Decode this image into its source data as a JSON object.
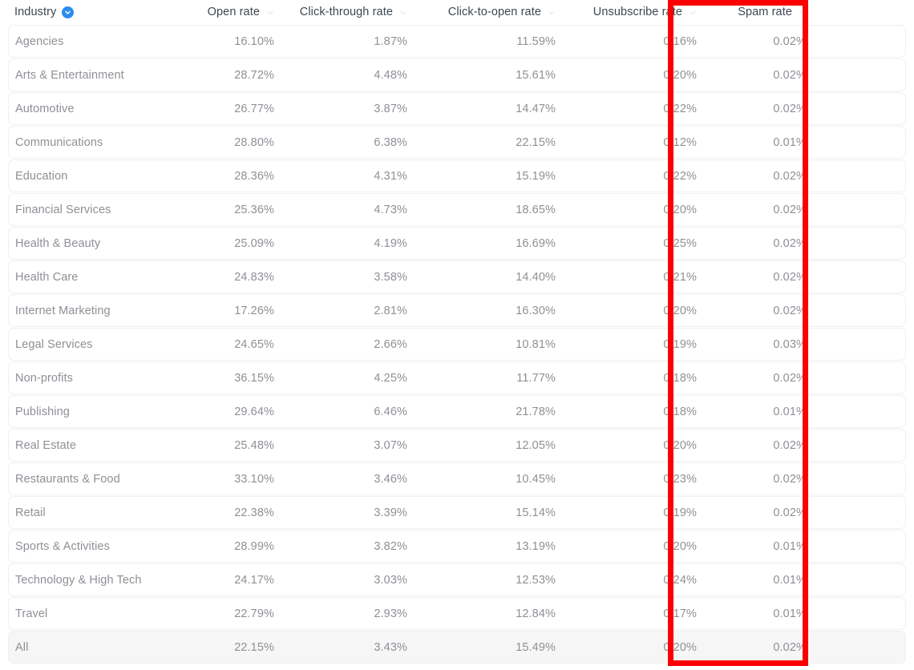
{
  "table": {
    "columns": [
      {
        "key": "industry",
        "label": "Industry",
        "sort_badge_icon": "chevron-down-icon",
        "sort_active": true
      },
      {
        "key": "open_rate",
        "label": "Open rate",
        "sort_icon": "chevron-down-icon",
        "sort_active": false
      },
      {
        "key": "click_through_rate",
        "label": "Click-through rate",
        "sort_icon": "chevron-down-icon",
        "sort_active": false
      },
      {
        "key": "click_to_open_rate",
        "label": "Click-to-open rate",
        "sort_icon": "chevron-down-icon",
        "sort_active": false
      },
      {
        "key": "unsubscribe_rate",
        "label": "Unsubscribe rate",
        "sort_icon": "chevron-down-icon",
        "sort_active": false
      },
      {
        "key": "spam_rate",
        "label": "Spam rate",
        "sort_icon": "chevron-down-icon",
        "sort_active": false
      }
    ],
    "rows": [
      {
        "industry": "Agencies",
        "open_rate": "16.10%",
        "click_through_rate": "1.87%",
        "click_to_open_rate": "11.59%",
        "unsubscribe_rate": "0.16%",
        "spam_rate": "0.02%",
        "is_total": false
      },
      {
        "industry": "Arts & Entertainment",
        "open_rate": "28.72%",
        "click_through_rate": "4.48%",
        "click_to_open_rate": "15.61%",
        "unsubscribe_rate": "0.20%",
        "spam_rate": "0.02%",
        "is_total": false
      },
      {
        "industry": "Automotive",
        "open_rate": "26.77%",
        "click_through_rate": "3.87%",
        "click_to_open_rate": "14.47%",
        "unsubscribe_rate": "0.22%",
        "spam_rate": "0.02%",
        "is_total": false
      },
      {
        "industry": "Communications",
        "open_rate": "28.80%",
        "click_through_rate": "6.38%",
        "click_to_open_rate": "22.15%",
        "unsubscribe_rate": "0.12%",
        "spam_rate": "0.01%",
        "is_total": false
      },
      {
        "industry": "Education",
        "open_rate": "28.36%",
        "click_through_rate": "4.31%",
        "click_to_open_rate": "15.19%",
        "unsubscribe_rate": "0.22%",
        "spam_rate": "0.02%",
        "is_total": false
      },
      {
        "industry": "Financial Services",
        "open_rate": "25.36%",
        "click_through_rate": "4.73%",
        "click_to_open_rate": "18.65%",
        "unsubscribe_rate": "0.20%",
        "spam_rate": "0.02%",
        "is_total": false
      },
      {
        "industry": "Health & Beauty",
        "open_rate": "25.09%",
        "click_through_rate": "4.19%",
        "click_to_open_rate": "16.69%",
        "unsubscribe_rate": "0.25%",
        "spam_rate": "0.02%",
        "is_total": false
      },
      {
        "industry": "Health Care",
        "open_rate": "24.83%",
        "click_through_rate": "3.58%",
        "click_to_open_rate": "14.40%",
        "unsubscribe_rate": "0.21%",
        "spam_rate": "0.02%",
        "is_total": false
      },
      {
        "industry": "Internet Marketing",
        "open_rate": "17.26%",
        "click_through_rate": "2.81%",
        "click_to_open_rate": "16.30%",
        "unsubscribe_rate": "0.20%",
        "spam_rate": "0.02%",
        "is_total": false
      },
      {
        "industry": "Legal Services",
        "open_rate": "24.65%",
        "click_through_rate": "2.66%",
        "click_to_open_rate": "10.81%",
        "unsubscribe_rate": "0.19%",
        "spam_rate": "0.03%",
        "is_total": false
      },
      {
        "industry": "Non-profits",
        "open_rate": "36.15%",
        "click_through_rate": "4.25%",
        "click_to_open_rate": "11.77%",
        "unsubscribe_rate": "0.18%",
        "spam_rate": "0.02%",
        "is_total": false
      },
      {
        "industry": "Publishing",
        "open_rate": "29.64%",
        "click_through_rate": "6.46%",
        "click_to_open_rate": "21.78%",
        "unsubscribe_rate": "0.18%",
        "spam_rate": "0.01%",
        "is_total": false
      },
      {
        "industry": "Real Estate",
        "open_rate": "25.48%",
        "click_through_rate": "3.07%",
        "click_to_open_rate": "12.05%",
        "unsubscribe_rate": "0.20%",
        "spam_rate": "0.02%",
        "is_total": false
      },
      {
        "industry": "Restaurants & Food",
        "open_rate": "33.10%",
        "click_through_rate": "3.46%",
        "click_to_open_rate": "10.45%",
        "unsubscribe_rate": "0.23%",
        "spam_rate": "0.02%",
        "is_total": false
      },
      {
        "industry": "Retail",
        "open_rate": "22.38%",
        "click_through_rate": "3.39%",
        "click_to_open_rate": "15.14%",
        "unsubscribe_rate": "0.19%",
        "spam_rate": "0.02%",
        "is_total": false
      },
      {
        "industry": "Sports & Activities",
        "open_rate": "28.99%",
        "click_through_rate": "3.82%",
        "click_to_open_rate": "13.19%",
        "unsubscribe_rate": "0.20%",
        "spam_rate": "0.01%",
        "is_total": false
      },
      {
        "industry": "Technology & High Tech",
        "open_rate": "24.17%",
        "click_through_rate": "3.03%",
        "click_to_open_rate": "12.53%",
        "unsubscribe_rate": "0.24%",
        "spam_rate": "0.01%",
        "is_total": false
      },
      {
        "industry": "Travel",
        "open_rate": "22.79%",
        "click_through_rate": "2.93%",
        "click_to_open_rate": "12.84%",
        "unsubscribe_rate": "0.17%",
        "spam_rate": "0.01%",
        "is_total": false
      },
      {
        "industry": "All",
        "open_rate": "22.15%",
        "click_through_rate": "3.43%",
        "click_to_open_rate": "15.49%",
        "unsubscribe_rate": "0.20%",
        "spam_rate": "0.02%",
        "is_total": true
      }
    ]
  },
  "annotation": {
    "type": "rectangle-highlight",
    "target_column": "Unsubscribe rate",
    "color": "#fb0000"
  },
  "colors": {
    "sort_badge": "#2d8cf0",
    "header_text": "#3f4650",
    "cell_text": "#8e9096",
    "row_bg": "#ffffff",
    "total_row_bg": "#f6f6f7",
    "row_border": "#f0f0f2",
    "annotation": "#fb0000"
  }
}
